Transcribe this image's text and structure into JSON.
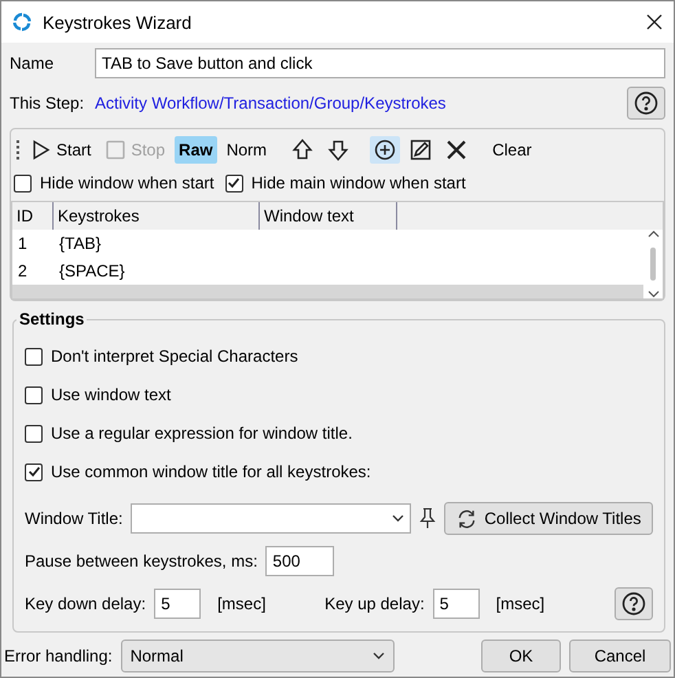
{
  "window": {
    "title": "Keystrokes Wizard"
  },
  "name": {
    "label": "Name",
    "value": "TAB to Save button and click"
  },
  "this_step": {
    "label": "This Step:",
    "link": "Activity Workflow/Transaction/Group/Keystrokes"
  },
  "toolbar": [
    {
      "kind": "play",
      "label": "Start",
      "disabled": false,
      "selected": false
    },
    {
      "kind": "stop",
      "label": "Stop",
      "disabled": true,
      "selected": false
    },
    {
      "kind": "text",
      "label": "Raw",
      "disabled": false,
      "selected": true
    },
    {
      "kind": "text",
      "label": "Norm",
      "disabled": false,
      "selected": false
    },
    {
      "kind": "up",
      "disabled": false,
      "selected": false
    },
    {
      "kind": "down",
      "disabled": false,
      "selected": false
    },
    {
      "kind": "add",
      "disabled": false,
      "selected": true
    },
    {
      "kind": "edit",
      "disabled": false,
      "selected": false
    },
    {
      "kind": "delete",
      "disabled": false,
      "selected": false
    },
    {
      "kind": "text",
      "label": "Clear",
      "disabled": false,
      "selected": false
    }
  ],
  "hide_options": [
    {
      "label": "Hide window when start",
      "checked": false
    },
    {
      "label": "Hide main window when start",
      "checked": true
    }
  ],
  "table": {
    "columns": [
      "ID",
      "Keystrokes",
      "Window text"
    ],
    "rows": [
      {
        "id": "1",
        "keystrokes": "{TAB}",
        "selected": false
      },
      {
        "id": "2",
        "keystrokes": "{SPACE}",
        "selected": false
      },
      {
        "selected": true
      }
    ]
  },
  "settings": {
    "title": "Settings",
    "options": [
      {
        "label": "Don't interpret Special Characters",
        "checked": false
      },
      {
        "label": "Use window text",
        "checked": false
      },
      {
        "label": "Use a regular expression for window title.",
        "checked": false
      },
      {
        "label": "Use common window title for all keystrokes:",
        "checked": true
      }
    ],
    "window_title": {
      "label": "Window Title:"
    },
    "collect_button": "Collect Window Titles",
    "pause": {
      "label": "Pause between keystrokes, ms:",
      "value": "500"
    },
    "key_down": {
      "label": "Key down delay:",
      "value": "5",
      "unit": "[msec]"
    },
    "key_up": {
      "label": "Key up delay:",
      "value": "5",
      "unit": "[msec]"
    }
  },
  "footer": {
    "error_label": "Error handling:",
    "error_value": "Normal",
    "buttons": [
      "OK",
      "Cancel"
    ]
  }
}
